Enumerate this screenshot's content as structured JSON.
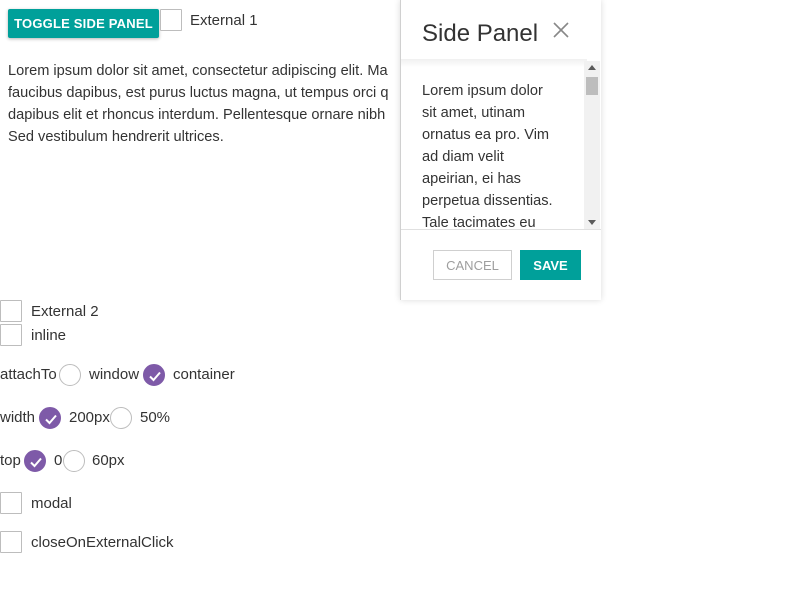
{
  "toolbar": {
    "toggle_label": "TOGGLE SIDE PANEL",
    "external1_label": "External 1"
  },
  "main_text": {
    "lines": [
      "Lorem ipsum dolor sit amet, consectetur adipiscing elit. Ma",
      "faucibus dapibus, est purus luctus magna, ut tempus orci q",
      "dapibus elit et rhoncus interdum. Pellentesque ornare nibh",
      "Sed vestibulum hendrerit ultrices."
    ]
  },
  "side_panel": {
    "title": "Side Panel",
    "content_lines": [
      "Lorem ipsum dolor",
      "sit amet, utinam",
      "ornatus ea pro. Vim",
      "ad diam velit",
      "apeirian, ei has",
      "perpetua dissentias.",
      "Tale tacimates eu"
    ],
    "cancel_label": "CANCEL",
    "save_label": "SAVE"
  },
  "options": {
    "external2_label": "External 2",
    "inline_label": "inline",
    "attach_to": {
      "label": "attachTo",
      "options": [
        "window",
        "container"
      ],
      "selected": "container"
    },
    "width": {
      "label": "width",
      "options": [
        "200px",
        "50%"
      ],
      "selected": "200px"
    },
    "top": {
      "label": "top",
      "options": [
        "0",
        "60px"
      ],
      "selected": "0"
    },
    "modal_label": "modal",
    "close_label": "closeOnExternalClick"
  },
  "colors": {
    "accent": "#00a09a",
    "radio_selected": "#7e5aa8"
  }
}
